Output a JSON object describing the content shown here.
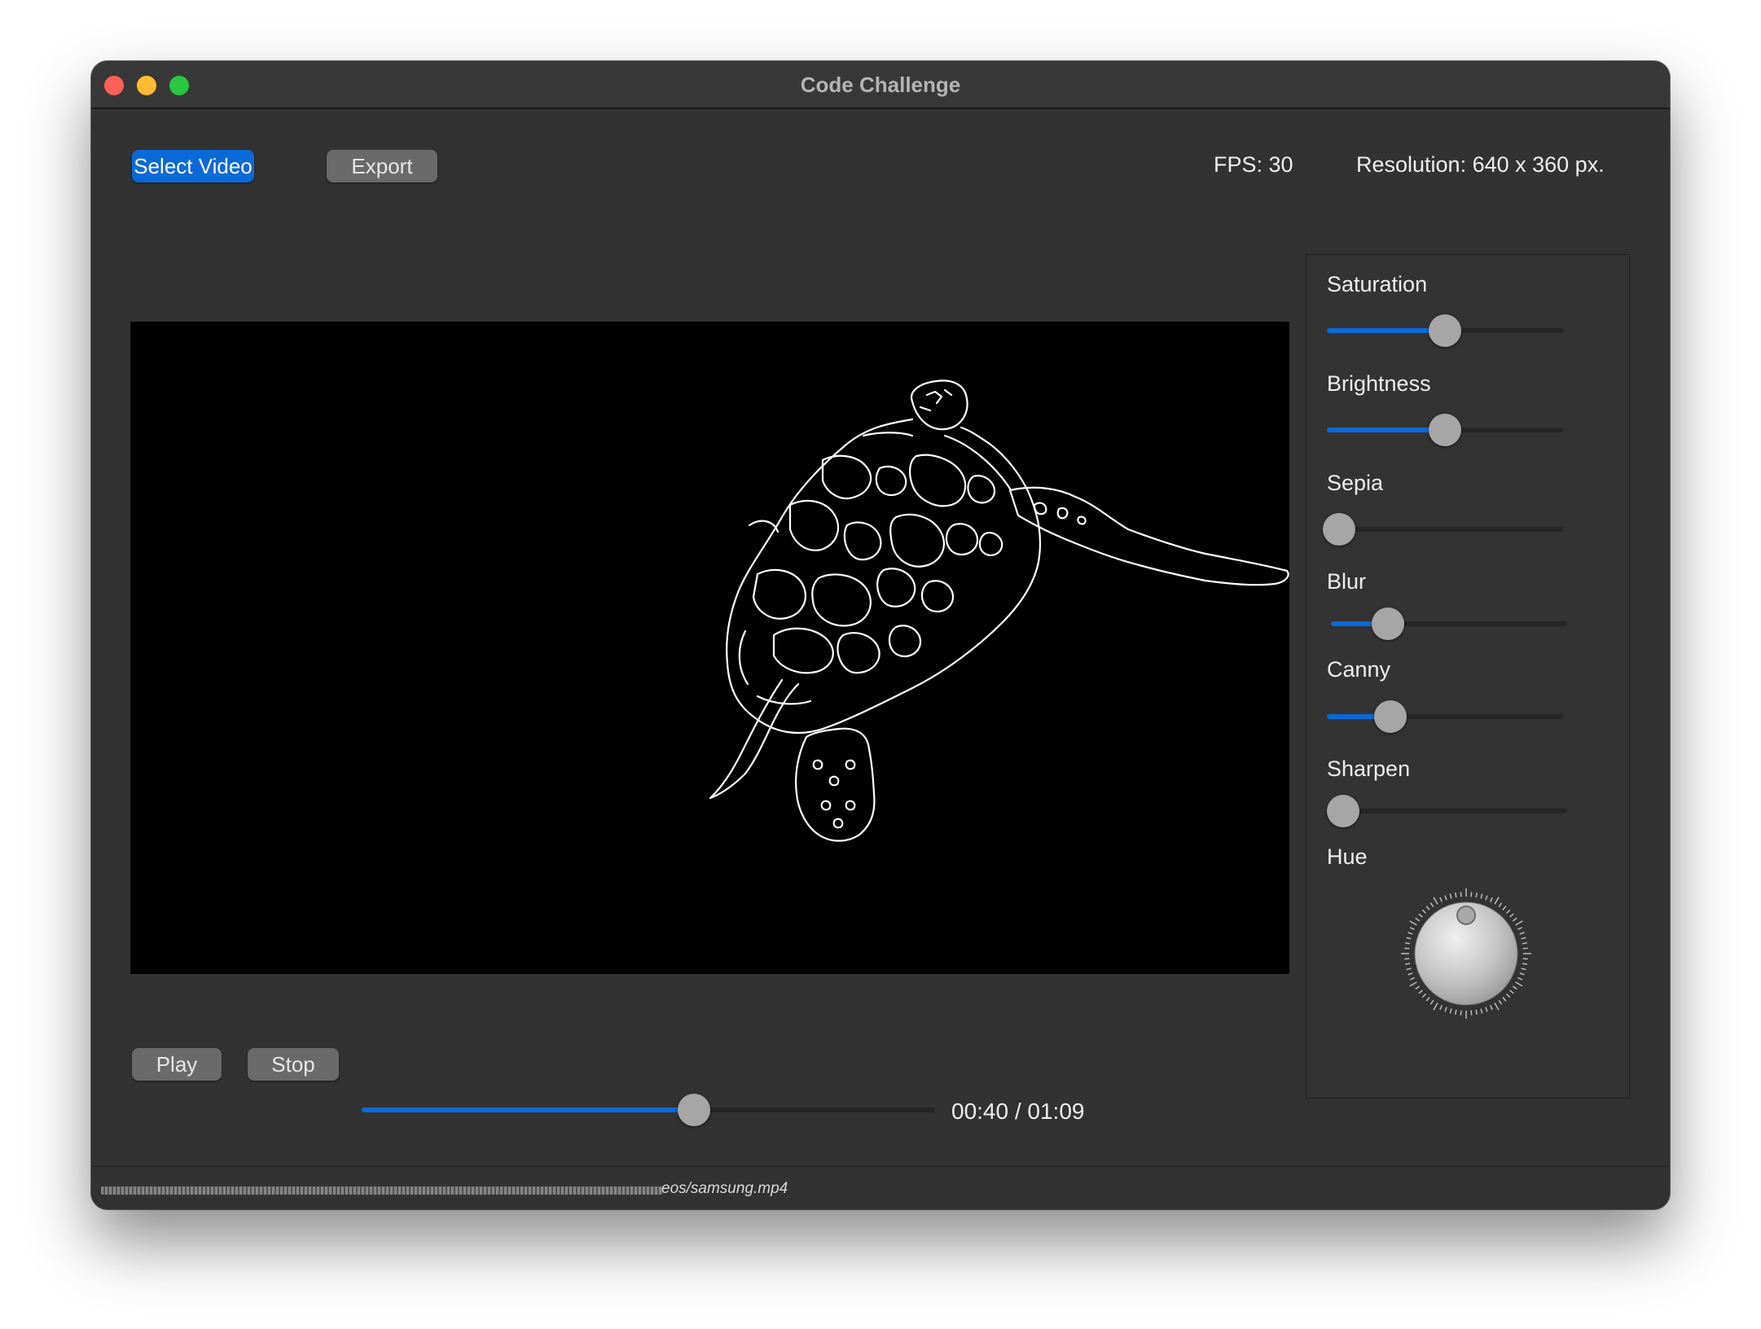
{
  "window": {
    "title": "Code Challenge"
  },
  "toolbar": {
    "select_video_label": "Select Video",
    "export_label": "Export",
    "fps_text": "FPS: 30",
    "resolution_text": "Resolution: 640 x 360 px."
  },
  "adjustments": {
    "sliders": [
      {
        "label": "Saturation",
        "value": 0.5
      },
      {
        "label": "Brightness",
        "value": 0.5
      },
      {
        "label": "Sepia",
        "value": 0.0
      },
      {
        "label": "Blur",
        "value": 0.24
      },
      {
        "label": "Canny",
        "value": 0.27
      },
      {
        "label": "Sharpen",
        "value": 0.0
      }
    ],
    "hue": {
      "label": "Hue",
      "value_degrees": 0
    }
  },
  "playback": {
    "play_label": "Play",
    "stop_label": "Stop",
    "progress": 0.58,
    "time_text": "00:40 / 01:09"
  },
  "status": {
    "path_text": "eos/samsung.mp4"
  },
  "colors": {
    "accent": "#0a69d9",
    "window_bg": "#323232",
    "video_bg": "#000000"
  }
}
